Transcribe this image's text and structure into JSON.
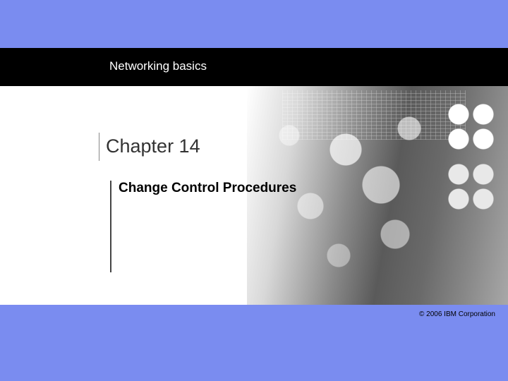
{
  "header": {
    "course_title": "Networking basics"
  },
  "content": {
    "chapter_label": "Chapter 14",
    "subtitle": "Change Control Procedures"
  },
  "footer": {
    "copyright": "© 2006 IBM Corporation"
  }
}
